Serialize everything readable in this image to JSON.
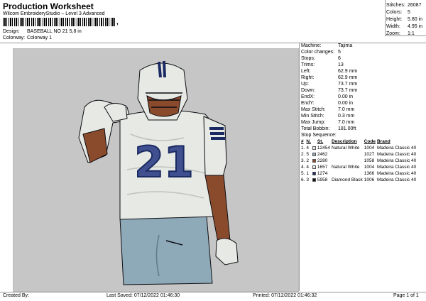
{
  "header": {
    "title": "Production Worksheet",
    "subtitle": "Wilcom EmbroideryStudio – Level 3 Advanced",
    "barcode_suffix": ",",
    "design_label": "Design:",
    "design_value": "BASEBALL NO 21 5,8 in",
    "colorway_label": "Colorway:",
    "colorway_value": "Colorway 1"
  },
  "stats": [
    {
      "label": "Stitches:",
      "value": "26087"
    },
    {
      "label": "Colors:",
      "value": "5"
    },
    {
      "label": "Height:",
      "value": "5.80 in"
    },
    {
      "label": "Width:",
      "value": "4.95 in"
    },
    {
      "label": "Zoom:",
      "value": "1:1"
    }
  ],
  "machine_info": [
    {
      "label": "Machine:",
      "value": "Tajima"
    },
    {
      "label": "Color changes:",
      "value": "5"
    },
    {
      "label": "Stops:",
      "value": "6"
    },
    {
      "label": "Trims:",
      "value": "13"
    },
    {
      "label": "Left:",
      "value": "62.9 mm"
    },
    {
      "label": "Right:",
      "value": "62.9 mm"
    },
    {
      "label": "Up:",
      "value": "73.7 mm"
    },
    {
      "label": "Down:",
      "value": "73.7 mm"
    },
    {
      "label": "EndX:",
      "value": "0.00 in"
    },
    {
      "label": "EndY:",
      "value": "0.00 in"
    },
    {
      "label": "Max Stitch:",
      "value": "7.0 mm"
    },
    {
      "label": "Min Stitch:",
      "value": "0.3 mm"
    },
    {
      "label": "Max Jump:",
      "value": "7.0 mm"
    },
    {
      "label": "Total Bobbin:",
      "value": "181.00ft"
    }
  ],
  "stop_sequence": {
    "caption": "Stop Sequence:",
    "headers": [
      "#",
      "N.",
      "St.",
      "Description",
      "Code",
      "Brand"
    ],
    "rows": [
      {
        "num": "1.",
        "n": "4",
        "color": "#e6e9e4",
        "st": "12454",
        "desc": "Natural White",
        "code": "1004",
        "brand": "Madeira Classic 40"
      },
      {
        "num": "2.",
        "n": "5",
        "color": "#8eaab8",
        "st": "2462",
        "desc": "",
        "code": "1027",
        "brand": "Madeira Classic 40"
      },
      {
        "num": "3.",
        "n": "2",
        "color": "#8a4a2c",
        "st": "2280",
        "desc": "",
        "code": "1058",
        "brand": "Madeira Classic 40"
      },
      {
        "num": "4.",
        "n": "4",
        "color": "#e6e9e4",
        "st": "1657",
        "desc": "Natural White",
        "code": "1004",
        "brand": "Madeira Classic 40"
      },
      {
        "num": "5.",
        "n": "1",
        "color": "#1c2a63",
        "st": "1274",
        "desc": "",
        "code": "1366",
        "brand": "Madeira Classic 40"
      },
      {
        "num": "6.",
        "n": "3",
        "color": "#0d0d12",
        "st": "5958",
        "desc": "Diamond Black",
        "code": "1006",
        "brand": "Madeira Classic 40"
      }
    ]
  },
  "design": {
    "jersey_number": "21",
    "colors": {
      "canvas": "#c6c6c6",
      "jersey": "#e6e9e4",
      "skin": "#8a4a2c",
      "navy": "#1c2a63",
      "number_fill": "#3f4f8f",
      "pants": "#8eaab8",
      "outline": "#0d0d12"
    }
  },
  "footer": {
    "created_by": "Created By:",
    "last_saved": "Last Saved: 07/12/2022 01:46:30",
    "printed": "Printed: 07/12/2022 01:46:32",
    "page": "Page 1 of 1"
  }
}
